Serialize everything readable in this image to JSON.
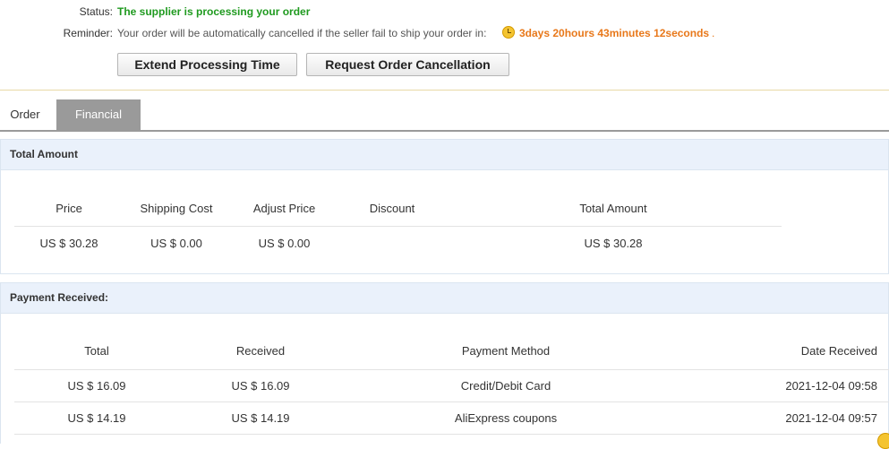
{
  "status": {
    "label": "Status:",
    "value": "The supplier is processing your order"
  },
  "reminder": {
    "label": "Reminder:",
    "text": "Your order will be automatically cancelled if the seller fail to ship your order in:",
    "countdown": "3days 20hours 43minutes 12seconds",
    "suffix": "."
  },
  "actions": {
    "extend_label": "Extend Processing Time",
    "cancel_label": "Request Order Cancellation"
  },
  "tabs": [
    {
      "label": "Order",
      "active": false
    },
    {
      "label": "Financial",
      "active": true
    }
  ],
  "total_amount": {
    "title": "Total Amount",
    "headers": [
      "Price",
      "Shipping Cost",
      "Adjust Price",
      "Discount",
      "Total Amount"
    ],
    "row": [
      "US $ 30.28",
      "US $ 0.00",
      "US $ 0.00",
      "",
      "US $ 30.28"
    ]
  },
  "payment_received": {
    "title": "Payment Received:",
    "headers": [
      "Total",
      "Received",
      "Payment Method",
      "Date Received"
    ],
    "rows": [
      [
        "US $ 16.09",
        "US $ 16.09",
        "Credit/Debit Card",
        "2021-12-04 09:58"
      ],
      [
        "US $ 14.19",
        "US $ 14.19",
        "AliExpress coupons",
        "2021-12-04 09:57"
      ]
    ]
  },
  "colors": {
    "status_green": "#1f9a1f",
    "countdown_orange": "#e8781a",
    "panel_header_bg": "#eaf1fb",
    "active_tab_bg": "#9a9a9a"
  },
  "icons": {
    "countdown": "clock-icon"
  }
}
